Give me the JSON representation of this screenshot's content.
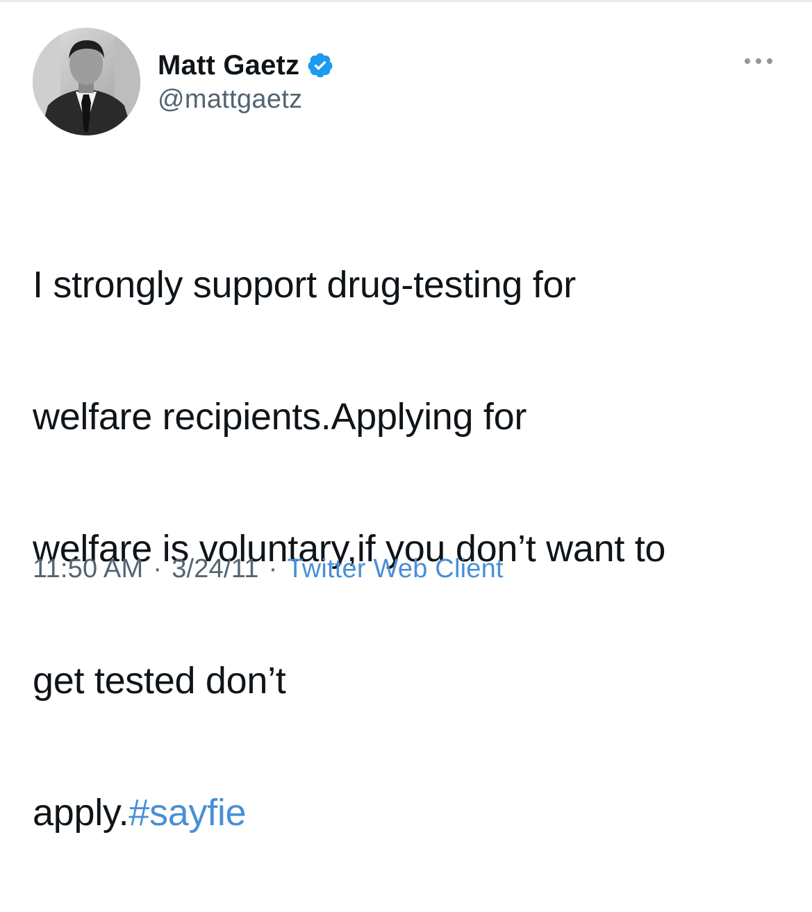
{
  "tweet": {
    "author": {
      "display_name": "Matt Gaetz",
      "handle": "@mattgaetz",
      "verified": true,
      "avatar_icon": "profile-photo"
    },
    "more_icon": "ellipsis-icon",
    "text_lines": [
      "I strongly support drug-testing for",
      "welfare recipients.Applying for",
      "welfare is voluntary,if you don’t want to",
      "get tested don’t"
    ],
    "last_line_text": "apply.",
    "hashtag": "#sayfie",
    "time": "11:50 AM",
    "separator": "·",
    "date": "3/24/11",
    "source": "Twitter Web Client"
  },
  "colors": {
    "link": "#4a8fd6",
    "verified": "#1d9bf0",
    "secondary_text": "#536471",
    "primary_text": "#0f1419"
  }
}
